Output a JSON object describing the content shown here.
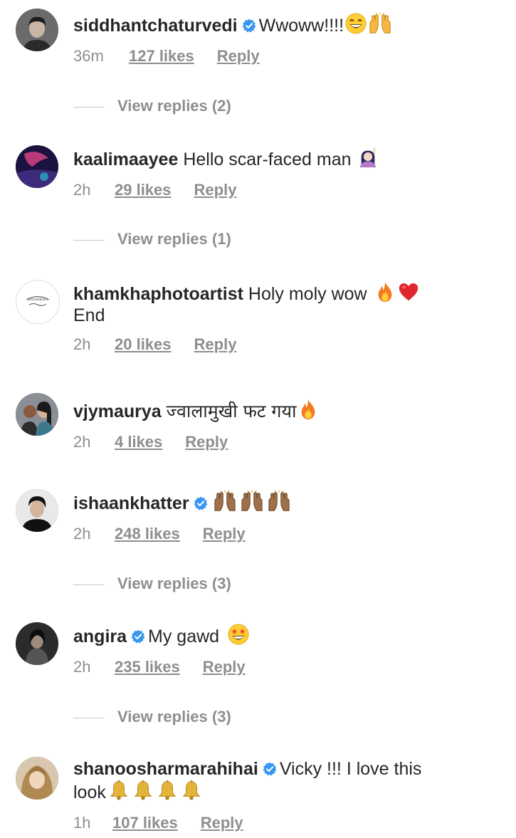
{
  "comments": [
    {
      "username": "siddhantchaturvedi",
      "verified": true,
      "text": "Wwoww!!!!",
      "emojis": [
        "grinning-face",
        "raising-hands"
      ],
      "time": "36m",
      "likes": "127 likes",
      "reply": "Reply",
      "view_replies": "View replies (2)"
    },
    {
      "username": "kaalimaayee",
      "verified": false,
      "text": "Hello scar-faced man",
      "emojis": [
        "raising-hand-woman"
      ],
      "time": "2h",
      "likes": "29 likes",
      "reply": "Reply",
      "view_replies": "View replies (1)"
    },
    {
      "username": "khamkhaphotoartist",
      "verified": false,
      "text": "Holy moly wow",
      "text_line2": "End",
      "emojis": [
        "fire",
        "red-heart"
      ],
      "time": "2h",
      "likes": "20 likes",
      "reply": "Reply"
    },
    {
      "username": "vjymaurya",
      "verified": false,
      "text": "ज्वालामुखी फट गया",
      "emojis": [
        "fire"
      ],
      "time": "2h",
      "likes": "4 likes",
      "reply": "Reply"
    },
    {
      "username": "ishaankhatter",
      "verified": true,
      "text": "",
      "emojis": [
        "raising-hands",
        "raising-hands",
        "raising-hands"
      ],
      "time": "2h",
      "likes": "248 likes",
      "reply": "Reply",
      "view_replies": "View replies (3)"
    },
    {
      "username": "angira",
      "verified": true,
      "text": "My gawd",
      "emojis": [
        "star-struck"
      ],
      "time": "2h",
      "likes": "235 likes",
      "reply": "Reply",
      "view_replies": "View replies (3)"
    },
    {
      "username": "shanoosharmarahihai",
      "verified": true,
      "text": "Vicky !!! I love this",
      "text_line2": "look",
      "emojis": [
        "bell",
        "bell",
        "bell",
        "bell"
      ],
      "time": "1h",
      "likes": "107 likes",
      "reply": "Reply"
    }
  ],
  "colors": {
    "text": "#262626",
    "muted": "#8e8e8e",
    "verified_blue": "#3897f0",
    "background": "#ffffff"
  }
}
